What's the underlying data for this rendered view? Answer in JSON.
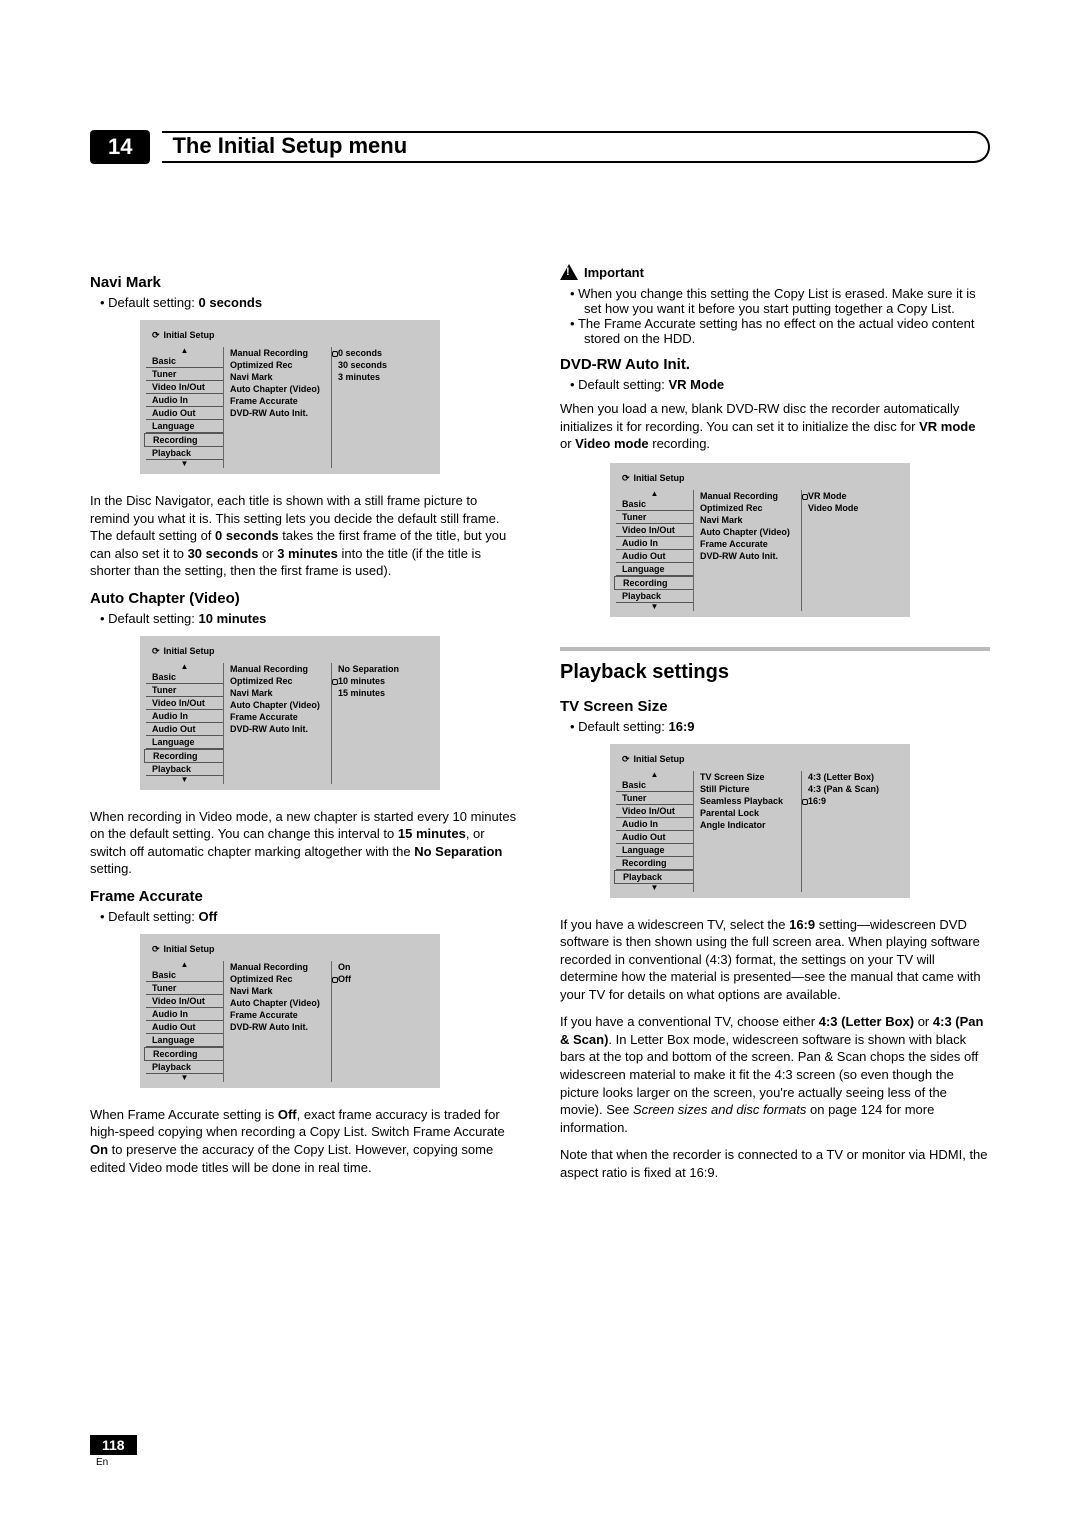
{
  "chapter": {
    "num": "14",
    "title": "The Initial Setup menu"
  },
  "menuCommon": {
    "header": "Initial Setup",
    "leftItems": [
      "Basic",
      "Tuner",
      "Video In/Out",
      "Audio In",
      "Audio Out",
      "Language",
      "Recording",
      "Playback"
    ]
  },
  "left": {
    "naviMark": {
      "heading": "Navi Mark",
      "defaultLabel": "Default setting: ",
      "defaultValue": "0 seconds",
      "midItems": [
        "Manual Recording",
        "Optimized Rec",
        "Navi Mark",
        "Auto Chapter (Video)",
        "Frame Accurate",
        "DVD-RW Auto Init."
      ],
      "options": [
        "0 seconds",
        "30 seconds",
        "3 minutes"
      ],
      "selected": 0,
      "body1a": "In the Disc Navigator, each title is shown with a still frame picture to remind you what it is. This setting lets you decide the default still frame. The default setting of ",
      "body1b": "0 seconds",
      "body1c": " takes the first frame of the title, but you can also set it to ",
      "body1d": "30 seconds",
      "body1e": " or ",
      "body1f": "3 minutes",
      "body1g": " into the title (if the title is shorter than the setting, then the first frame is used)."
    },
    "autoChapter": {
      "heading": "Auto Chapter (Video)",
      "defaultLabel": "Default setting: ",
      "defaultValue": "10 minutes",
      "midItems": [
        "Manual Recording",
        "Optimized Rec",
        "Navi Mark",
        "Auto Chapter (Video)",
        "Frame Accurate",
        "DVD-RW Auto Init."
      ],
      "options": [
        "No Separation",
        "10 minutes",
        "15 minutes"
      ],
      "selected": 1,
      "body1a": "When recording in Video mode, a new chapter is started every 10 minutes on the default setting. You can change this interval to ",
      "body1b": "15 minutes",
      "body1c": ", or switch off automatic chapter marking altogether with the ",
      "body1d": "No Separation",
      "body1e": " setting."
    },
    "frameAccurate": {
      "heading": "Frame Accurate",
      "defaultLabel": "Default setting: ",
      "defaultValue": "Off",
      "midItems": [
        "Manual Recording",
        "Optimized Rec",
        "Navi Mark",
        "Auto Chapter (Video)",
        "Frame Accurate",
        "DVD-RW Auto Init."
      ],
      "options": [
        "On",
        "Off"
      ],
      "selected": 1,
      "body1a": "When Frame Accurate setting is ",
      "body1b": "Off",
      "body1c": ", exact frame accuracy is traded for high-speed copying when recording a Copy List. Switch Frame Accurate ",
      "body1d": "On",
      "body1e": " to preserve the accuracy of the Copy List. However, copying some edited Video mode titles will be done in real time."
    }
  },
  "right": {
    "important": {
      "heading": "Important",
      "b1": "When you change this setting the Copy List is erased. Make sure it is set how you want it before you start putting together a Copy List.",
      "b2": "The Frame Accurate setting has no effect on the actual video content stored on the HDD."
    },
    "dvdrw": {
      "heading": "DVD-RW Auto Init.",
      "defaultLabel": "Default setting: ",
      "defaultValue": "VR Mode",
      "intro_a": "When you load a new, blank DVD-RW disc the recorder automatically initializes it for recording. You can set it to initialize the disc for ",
      "intro_b": "VR mode",
      "intro_c": " or ",
      "intro_d": "Video mode",
      "intro_e": " recording.",
      "midItems": [
        "Manual Recording",
        "Optimized Rec",
        "Navi Mark",
        "Auto Chapter (Video)",
        "Frame Accurate",
        "DVD-RW Auto Init."
      ],
      "options": [
        "VR Mode",
        "Video Mode"
      ],
      "selected": 0
    },
    "playback": {
      "sectionHeading": "Playback settings",
      "tvScreen": {
        "heading": "TV Screen Size",
        "defaultLabel": "Default setting: ",
        "defaultValue": "16:9",
        "midItems": [
          "TV Screen Size",
          "Still Picture",
          "Seamless Playback",
          "Parental Lock",
          "Angle Indicator"
        ],
        "options": [
          "4:3 (Letter Box)",
          "4:3 (Pan & Scan)",
          "16:9"
        ],
        "selected": 2,
        "p1a": "If you have a widescreen TV, select the ",
        "p1b": "16:9",
        "p1c": " setting—widescreen DVD software is then shown using the full screen area. When playing software recorded in conventional (4:3) format, the settings on your TV will determine how the material is presented—see the manual that came with your TV for details on what options are available.",
        "p2a": "If you have a conventional TV, choose either ",
        "p2b": "4:3 (Letter Box)",
        "p2c": " or ",
        "p2d": "4:3 (Pan & Scan)",
        "p2e": ". In Letter Box mode, widescreen software is shown with black bars at the top and bottom of the screen. Pan & Scan chops the sides off widescreen material to make it fit the 4:3 screen (so even though the picture looks larger on the screen, you're actually seeing less of the movie). See ",
        "p2f": "Screen sizes and disc formats",
        "p2g": " on page 124 for more information.",
        "p3": "Note that when the recorder is connected to a TV or monitor via HDMI, the aspect ratio is fixed at 16:9."
      }
    }
  },
  "footer": {
    "page": "118",
    "lang": "En"
  }
}
